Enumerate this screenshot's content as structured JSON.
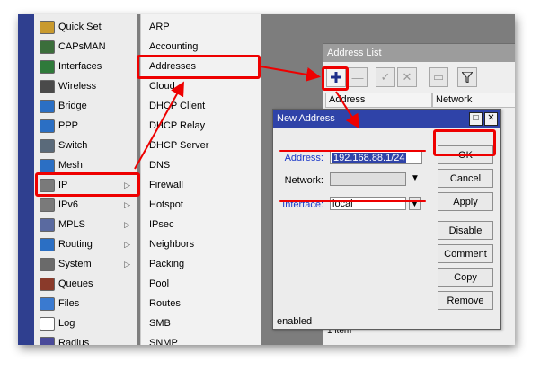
{
  "menu": {
    "items": [
      {
        "label": "Quick Set",
        "icon": "quick-set-icon",
        "color": "#c99a2e"
      },
      {
        "label": "CAPsMAN",
        "icon": "capsman-icon",
        "color": "#3b6e3b"
      },
      {
        "label": "Interfaces",
        "icon": "interfaces-icon",
        "color": "#2f7a3a"
      },
      {
        "label": "Wireless",
        "icon": "wireless-icon",
        "color": "#4a4a4a"
      },
      {
        "label": "Bridge",
        "icon": "bridge-icon",
        "color": "#2b6fc4"
      },
      {
        "label": "PPP",
        "icon": "ppp-icon",
        "color": "#2b6fc4"
      },
      {
        "label": "Switch",
        "icon": "switch-icon",
        "color": "#5a6a7a"
      },
      {
        "label": "Mesh",
        "icon": "mesh-icon",
        "color": "#2b6fc4"
      },
      {
        "label": "IP",
        "icon": "ip-icon",
        "color": "#7a7a7a"
      },
      {
        "label": "IPv6",
        "icon": "ipv6-icon",
        "color": "#7a7a7a"
      },
      {
        "label": "MPLS",
        "icon": "mpls-icon",
        "color": "#5a6aa0"
      },
      {
        "label": "Routing",
        "icon": "routing-icon",
        "color": "#2b6fc4"
      },
      {
        "label": "System",
        "icon": "system-icon",
        "color": "#6a6a6a"
      },
      {
        "label": "Queues",
        "icon": "queues-icon",
        "color": "#8a3a2a"
      },
      {
        "label": "Files",
        "icon": "files-icon",
        "color": "#3a7ad0"
      },
      {
        "label": "Log",
        "icon": "log-icon",
        "color": "#ffffff"
      },
      {
        "label": "Radius",
        "icon": "radius-icon",
        "color": "#4a4a9a"
      }
    ]
  },
  "submenu": {
    "items": [
      "ARP",
      "Accounting",
      "Addresses",
      "Cloud",
      "DHCP Client",
      "DHCP Relay",
      "DHCP Server",
      "DNS",
      "Firewall",
      "Hotspot",
      "IPsec",
      "Neighbors",
      "Packing",
      "Pool",
      "Routes",
      "SMB",
      "SNMP"
    ]
  },
  "address_list": {
    "title": "Address List",
    "columns": [
      "Address",
      "Network"
    ],
    "footer": "1 item"
  },
  "dialog": {
    "title": "New Address",
    "address_label": "Address:",
    "address_value": "192.168.88.1/24",
    "network_label": "Network:",
    "network_value": "",
    "interface_label": "Interface:",
    "interface_value": "local",
    "buttons": [
      "OK",
      "Cancel",
      "Apply",
      "Disable",
      "Comment",
      "Copy",
      "Remove"
    ],
    "status": "enabled"
  },
  "colors": {
    "highlight": "#ee0000",
    "title_active": "#2f43a8",
    "label_link": "#1a38c8"
  }
}
